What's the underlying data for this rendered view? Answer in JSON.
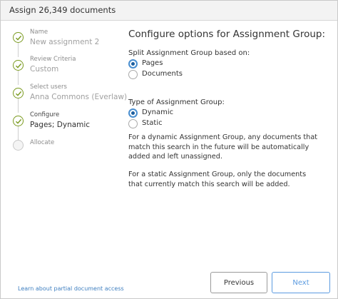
{
  "dialog": {
    "title": "Assign 26,349 documents"
  },
  "steps": [
    {
      "label": "Name",
      "value": "New assignment 2",
      "state": "done"
    },
    {
      "label": "Review Criteria",
      "value": "Custom",
      "state": "done"
    },
    {
      "label": "Select users",
      "value": "Anna Commons (Everlaw)",
      "state": "done"
    },
    {
      "label": "Configure",
      "value": "Pages; Dynamic",
      "state": "current"
    },
    {
      "label": "Allocate",
      "value": "",
      "state": "pending"
    }
  ],
  "main": {
    "heading": "Configure options for Assignment Group:",
    "split": {
      "label": "Split Assignment Group based on:",
      "options": [
        {
          "label": "Pages",
          "checked": true
        },
        {
          "label": "Documents",
          "checked": false
        }
      ]
    },
    "type": {
      "label": "Type of Assignment Group:",
      "options": [
        {
          "label": "Dynamic",
          "checked": true
        },
        {
          "label": "Static",
          "checked": false
        }
      ]
    },
    "dynamic_text": "For a dynamic Assignment Group, any documents that match this search in the future will be automatically added and left unassigned.",
    "static_text": "For a static Assignment Group, only the documents that currently match this search will be added."
  },
  "footer": {
    "learn_link": "Learn about partial document access",
    "previous_label": "Previous",
    "next_label": "Next"
  },
  "colors": {
    "step_done": "#7a9a1f",
    "radio_selected": "#1d5f9f",
    "link": "#3f7fc0",
    "next_button": "#5b9be0"
  }
}
